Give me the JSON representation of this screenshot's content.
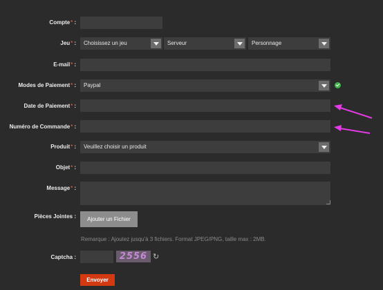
{
  "form": {
    "compte": {
      "label": "Compte",
      "required": "*",
      "colon": ":"
    },
    "jeu": {
      "label": "Jeu",
      "required": "*",
      "colon": ":",
      "select_jeu": "Choisissez un jeu",
      "select_serveur": "Serveur",
      "select_personnage": "Personnage"
    },
    "email": {
      "label": "E-mail",
      "required": "*",
      "colon": ":"
    },
    "modes": {
      "label": "Modes de Paiement",
      "required": "*",
      "colon": ":",
      "value": "Paypal"
    },
    "date": {
      "label": "Date de Paiement",
      "required": "*",
      "colon": ":"
    },
    "numero": {
      "label": "Numéro de Commande",
      "required": "*",
      "colon": ":"
    },
    "produit": {
      "label": "Produit",
      "required": "*",
      "colon": ":",
      "value": "Veuillez choisir un produit"
    },
    "objet": {
      "label": "Objet",
      "required": "*",
      "colon": ":"
    },
    "message": {
      "label": "Message",
      "required": "*",
      "colon": ":"
    },
    "pieces": {
      "label": "Pièces Jointes :",
      "button": "Ajouter un Fichier",
      "note": "Remarque : Ajoutez jusqu'à 3 fichiers. Format JPEG/PNG, taille max : 2MB."
    },
    "captcha": {
      "label": "Captcha :",
      "image_text": "2556"
    },
    "submit": "Envoyer"
  },
  "colors": {
    "background": "#2b2b2b",
    "field": "#3d3d3d",
    "accent": "#d33a12",
    "annotation_arrow": "#e63ae6",
    "valid": "#3fb54a"
  },
  "icons": {
    "dropdown": "chevron-down-icon",
    "valid": "check-circle-icon",
    "refresh": "refresh-icon",
    "annotation": "arrow-annotation"
  }
}
